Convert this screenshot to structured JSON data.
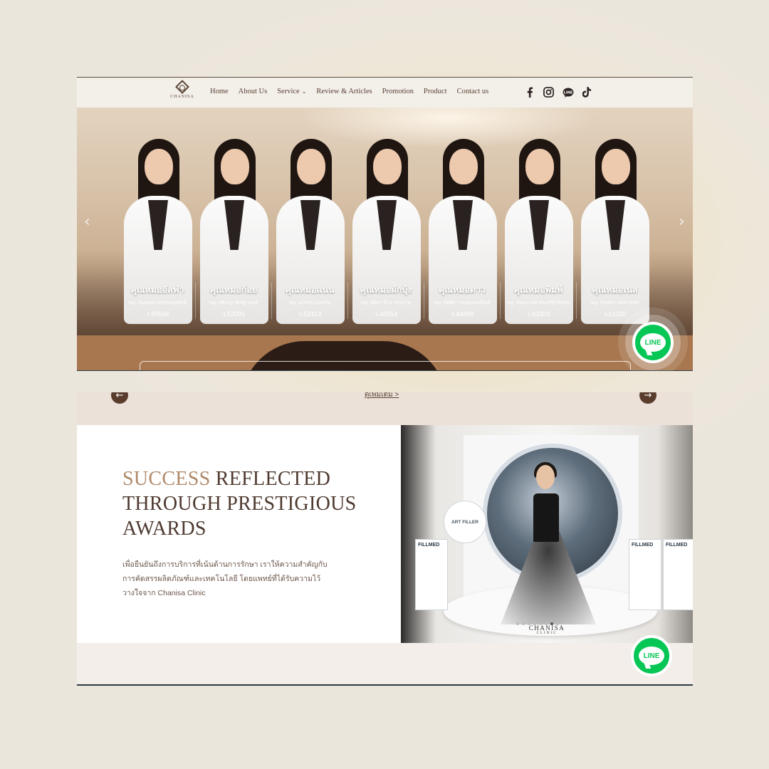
{
  "brand": {
    "logo_text": "CHANISA"
  },
  "nav": {
    "items": [
      {
        "label": "Home"
      },
      {
        "label": "About Us"
      },
      {
        "label": "Service"
      },
      {
        "label": "Review & Articles"
      },
      {
        "label": "Promotion"
      },
      {
        "label": "Product"
      },
      {
        "label": "Contact us"
      }
    ],
    "socials": [
      "facebook-icon",
      "instagram-icon",
      "line-icon",
      "tiktok-icon"
    ],
    "line_social_text": "LINE"
  },
  "hero": {
    "prev_arrow": "‹",
    "next_arrow": "›",
    "doctors": [
      {
        "name": "คุณหมออัลฟ่า",
        "full_name": "พญ. กัญญมล ทองประมูลศักดิ์",
        "license": "ว.60506"
      },
      {
        "name": "คุณหมอก้อย",
        "full_name": "พญ. สุพิชญา พิเชฐานนท์",
        "license": "ว.53091"
      },
      {
        "name": "คุณหมอแนน",
        "full_name": "พญ. นภัสรส มงคลกิจ",
        "license": "ว.52413"
      },
      {
        "name": "คุณหมอผักบุ้ง",
        "full_name": "พญ. ชนิศา อำนาจกุลวาท",
        "license": "ว.45014"
      },
      {
        "name": "คุณหมอดาว",
        "full_name": "พญ. ทิตศิดา จตุรยะพงษ์พันธ์",
        "license": "ว.44899"
      },
      {
        "name": "คุณหมอพิมพ์",
        "full_name": "พญ. พิมพกานต์ ประเสริฐวิรัชชัย",
        "license": "ว.63303"
      },
      {
        "name": "คุณหมอเนส",
        "full_name": "พญ. ปัณฑิตา ผลทำเพชร",
        "license": "ว.61320"
      }
    ]
  },
  "line_button": {
    "label": "LINE"
  },
  "reviews_slider": {
    "prev_arrow": "←",
    "next_arrow": "→",
    "see_more": "ดูเพิ่มเติม >"
  },
  "awards": {
    "title_accent": "SUCCESS",
    "title_rest": " REFLECTED THROUGH PRESTIGIOUS AWARDS",
    "description": "เพื่อยืนยันถึงการบริการที่เน้นด้านการรักษา เราให้ความสำคัญกับการคัดสรรผลิตภัณฑ์และเทคโนโลยี โดยแพทย์ที่ได้รับความไว้วางใจจาก Chanisa Clinic",
    "photo": {
      "sign_text": "ART FILLER",
      "box_left": "FILLMED",
      "box_right_1": "FILLMED",
      "box_right_2": "FILLMED",
      "brand_text": "CHANISA",
      "brand_sub": "CLINIC"
    },
    "dots_total": 8,
    "dots_active": 6
  },
  "colors": {
    "brand_brown": "#5a4336",
    "accent_gold": "#b08a6b",
    "line_green": "#06c755"
  }
}
